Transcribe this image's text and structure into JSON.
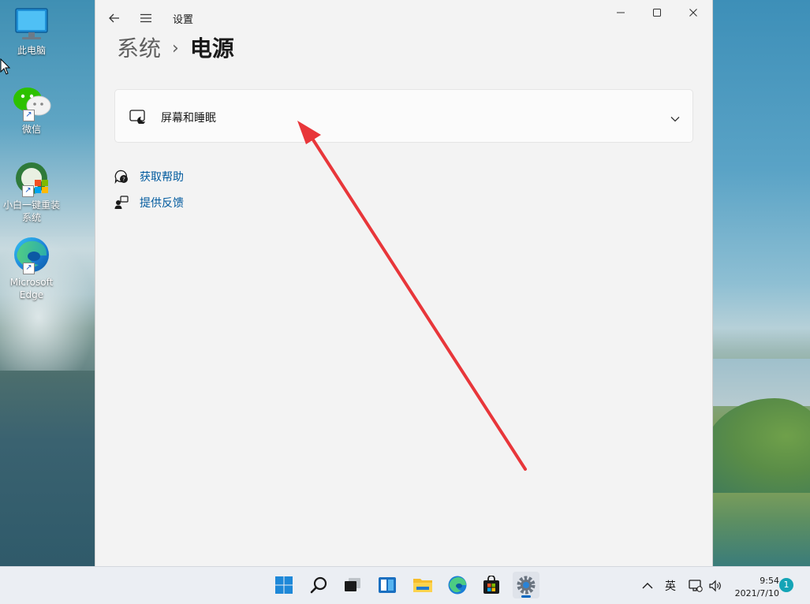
{
  "desktop": {
    "icons": [
      {
        "label": "此电脑",
        "icon": "computer-icon"
      },
      {
        "label": "微信",
        "icon": "wechat-icon"
      },
      {
        "label_line1": "小白一键重装",
        "label_line2": "系统",
        "icon": "xiaobai-installer-icon"
      },
      {
        "label_line1": "Microsoft",
        "label_line2": "Edge",
        "icon": "edge-icon"
      }
    ]
  },
  "window": {
    "app_title": "设置",
    "breadcrumb": {
      "parent": "系统",
      "separator": "›",
      "current": "电源"
    },
    "card": {
      "label": "屏幕和睡眠",
      "icon": "screen-sleep-icon",
      "chevron": "chevron-down-icon"
    },
    "links": [
      {
        "label": "获取帮助",
        "icon": "help-chat-icon"
      },
      {
        "label": "提供反馈",
        "icon": "feedback-icon"
      }
    ],
    "controls": {
      "minimize": "minimize-icon",
      "maximize": "maximize-icon",
      "close": "close-icon"
    }
  },
  "taskbar": {
    "apps": [
      "start-icon",
      "search-icon",
      "task-view-icon",
      "widgets-icon",
      "file-explorer-icon",
      "edge-icon",
      "store-icon",
      "settings-icon"
    ],
    "active_app": "settings-icon",
    "tray": {
      "ime": "英",
      "time": "9:54",
      "date": "2021/7/10",
      "notification_count": "1"
    }
  },
  "colors": {
    "accent": "#0067c0",
    "link": "#005a9e",
    "annotation_arrow": "#e8363a",
    "notification_badge": "#14a4b6"
  }
}
